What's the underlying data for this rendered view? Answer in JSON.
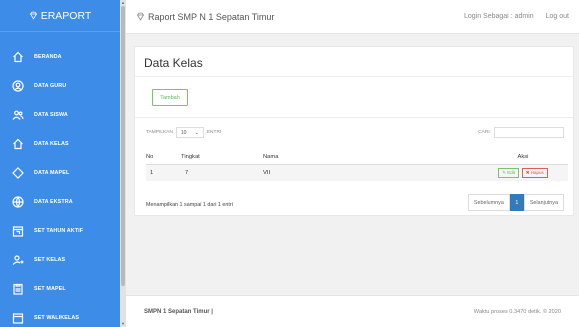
{
  "brand": {
    "name": "ERAPORT"
  },
  "sidebar": {
    "items": [
      {
        "label": "BERANDA",
        "icon": "home-icon"
      },
      {
        "label": "DATA GURU",
        "icon": "user-circle-icon"
      },
      {
        "label": "DATA SISWA",
        "icon": "students-icon"
      },
      {
        "label": "DATA KELAS",
        "icon": "home-icon"
      },
      {
        "label": "DATA MAPEL",
        "icon": "diamond-icon"
      },
      {
        "label": "DATA EKSTRA",
        "icon": "globe-icon"
      },
      {
        "label": "SET TAHUN AKTIF",
        "icon": "calendar-icon"
      },
      {
        "label": "SET KELAS",
        "icon": "user-add-icon"
      },
      {
        "label": "SET MAPEL",
        "icon": "clipboard-icon"
      },
      {
        "label": "SET WALIKELAS",
        "icon": "file-icon"
      }
    ]
  },
  "topbar": {
    "title": "Raport SMP N 1 Sepatan Timur",
    "login": "Login Sebagai : admin",
    "logout": "Log out"
  },
  "main": {
    "heading": "Data Kelas",
    "add_button": "Tambah",
    "show_label_pre": "TAMPILKAN",
    "show_value": "10",
    "show_label_post": "ENTRI",
    "search_label": "CARI:",
    "columns": [
      "No",
      "Tingkat",
      "Nama",
      "Aksi"
    ],
    "rows": [
      {
        "no": "1",
        "tingkat": "7",
        "nama": "VII",
        "edit": "Edit",
        "delete": "Hapus"
      }
    ],
    "info": "Menampilkan 1 sampai 1 dari 1 entri",
    "pager": {
      "prev": "Sebelumnya",
      "current": "1",
      "next": "Selanjutnya"
    }
  },
  "footer": {
    "left": "SMPN 1 Sepatan Timur |",
    "right": "Waktu proses 0.3470 detik. © 2020"
  },
  "colors": {
    "sidebar": "#3d8ce8",
    "success": "#5cb85c",
    "danger": "#d9534f",
    "primary": "#337ab7"
  }
}
